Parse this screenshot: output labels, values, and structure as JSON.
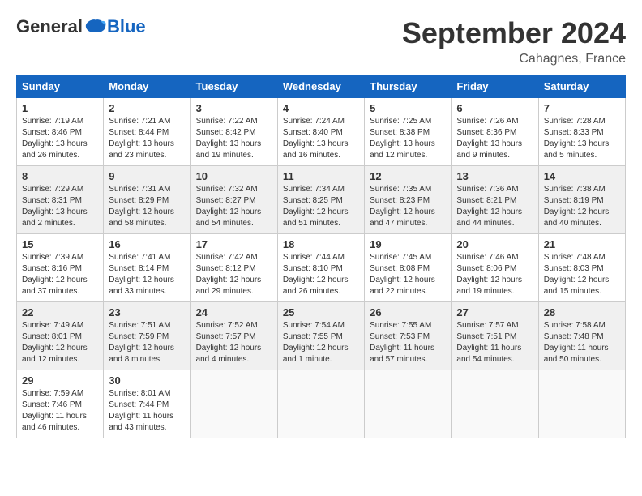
{
  "header": {
    "logo": {
      "general": "General",
      "blue": "Blue"
    },
    "title": "September 2024",
    "location": "Cahagnes, France"
  },
  "weekdays": [
    "Sunday",
    "Monday",
    "Tuesday",
    "Wednesday",
    "Thursday",
    "Friday",
    "Saturday"
  ],
  "weeks": [
    [
      {
        "day": "1",
        "sunrise": "Sunrise: 7:19 AM",
        "sunset": "Sunset: 8:46 PM",
        "daylight": "Daylight: 13 hours and 26 minutes."
      },
      {
        "day": "2",
        "sunrise": "Sunrise: 7:21 AM",
        "sunset": "Sunset: 8:44 PM",
        "daylight": "Daylight: 13 hours and 23 minutes."
      },
      {
        "day": "3",
        "sunrise": "Sunrise: 7:22 AM",
        "sunset": "Sunset: 8:42 PM",
        "daylight": "Daylight: 13 hours and 19 minutes."
      },
      {
        "day": "4",
        "sunrise": "Sunrise: 7:24 AM",
        "sunset": "Sunset: 8:40 PM",
        "daylight": "Daylight: 13 hours and 16 minutes."
      },
      {
        "day": "5",
        "sunrise": "Sunrise: 7:25 AM",
        "sunset": "Sunset: 8:38 PM",
        "daylight": "Daylight: 13 hours and 12 minutes."
      },
      {
        "day": "6",
        "sunrise": "Sunrise: 7:26 AM",
        "sunset": "Sunset: 8:36 PM",
        "daylight": "Daylight: 13 hours and 9 minutes."
      },
      {
        "day": "7",
        "sunrise": "Sunrise: 7:28 AM",
        "sunset": "Sunset: 8:33 PM",
        "daylight": "Daylight: 13 hours and 5 minutes."
      }
    ],
    [
      {
        "day": "8",
        "sunrise": "Sunrise: 7:29 AM",
        "sunset": "Sunset: 8:31 PM",
        "daylight": "Daylight: 13 hours and 2 minutes."
      },
      {
        "day": "9",
        "sunrise": "Sunrise: 7:31 AM",
        "sunset": "Sunset: 8:29 PM",
        "daylight": "Daylight: 12 hours and 58 minutes."
      },
      {
        "day": "10",
        "sunrise": "Sunrise: 7:32 AM",
        "sunset": "Sunset: 8:27 PM",
        "daylight": "Daylight: 12 hours and 54 minutes."
      },
      {
        "day": "11",
        "sunrise": "Sunrise: 7:34 AM",
        "sunset": "Sunset: 8:25 PM",
        "daylight": "Daylight: 12 hours and 51 minutes."
      },
      {
        "day": "12",
        "sunrise": "Sunrise: 7:35 AM",
        "sunset": "Sunset: 8:23 PM",
        "daylight": "Daylight: 12 hours and 47 minutes."
      },
      {
        "day": "13",
        "sunrise": "Sunrise: 7:36 AM",
        "sunset": "Sunset: 8:21 PM",
        "daylight": "Daylight: 12 hours and 44 minutes."
      },
      {
        "day": "14",
        "sunrise": "Sunrise: 7:38 AM",
        "sunset": "Sunset: 8:19 PM",
        "daylight": "Daylight: 12 hours and 40 minutes."
      }
    ],
    [
      {
        "day": "15",
        "sunrise": "Sunrise: 7:39 AM",
        "sunset": "Sunset: 8:16 PM",
        "daylight": "Daylight: 12 hours and 37 minutes."
      },
      {
        "day": "16",
        "sunrise": "Sunrise: 7:41 AM",
        "sunset": "Sunset: 8:14 PM",
        "daylight": "Daylight: 12 hours and 33 minutes."
      },
      {
        "day": "17",
        "sunrise": "Sunrise: 7:42 AM",
        "sunset": "Sunset: 8:12 PM",
        "daylight": "Daylight: 12 hours and 29 minutes."
      },
      {
        "day": "18",
        "sunrise": "Sunrise: 7:44 AM",
        "sunset": "Sunset: 8:10 PM",
        "daylight": "Daylight: 12 hours and 26 minutes."
      },
      {
        "day": "19",
        "sunrise": "Sunrise: 7:45 AM",
        "sunset": "Sunset: 8:08 PM",
        "daylight": "Daylight: 12 hours and 22 minutes."
      },
      {
        "day": "20",
        "sunrise": "Sunrise: 7:46 AM",
        "sunset": "Sunset: 8:06 PM",
        "daylight": "Daylight: 12 hours and 19 minutes."
      },
      {
        "day": "21",
        "sunrise": "Sunrise: 7:48 AM",
        "sunset": "Sunset: 8:03 PM",
        "daylight": "Daylight: 12 hours and 15 minutes."
      }
    ],
    [
      {
        "day": "22",
        "sunrise": "Sunrise: 7:49 AM",
        "sunset": "Sunset: 8:01 PM",
        "daylight": "Daylight: 12 hours and 12 minutes."
      },
      {
        "day": "23",
        "sunrise": "Sunrise: 7:51 AM",
        "sunset": "Sunset: 7:59 PM",
        "daylight": "Daylight: 12 hours and 8 minutes."
      },
      {
        "day": "24",
        "sunrise": "Sunrise: 7:52 AM",
        "sunset": "Sunset: 7:57 PM",
        "daylight": "Daylight: 12 hours and 4 minutes."
      },
      {
        "day": "25",
        "sunrise": "Sunrise: 7:54 AM",
        "sunset": "Sunset: 7:55 PM",
        "daylight": "Daylight: 12 hours and 1 minute."
      },
      {
        "day": "26",
        "sunrise": "Sunrise: 7:55 AM",
        "sunset": "Sunset: 7:53 PM",
        "daylight": "Daylight: 11 hours and 57 minutes."
      },
      {
        "day": "27",
        "sunrise": "Sunrise: 7:57 AM",
        "sunset": "Sunset: 7:51 PM",
        "daylight": "Daylight: 11 hours and 54 minutes."
      },
      {
        "day": "28",
        "sunrise": "Sunrise: 7:58 AM",
        "sunset": "Sunset: 7:48 PM",
        "daylight": "Daylight: 11 hours and 50 minutes."
      }
    ],
    [
      {
        "day": "29",
        "sunrise": "Sunrise: 7:59 AM",
        "sunset": "Sunset: 7:46 PM",
        "daylight": "Daylight: 11 hours and 46 minutes."
      },
      {
        "day": "30",
        "sunrise": "Sunrise: 8:01 AM",
        "sunset": "Sunset: 7:44 PM",
        "daylight": "Daylight: 11 hours and 43 minutes."
      },
      null,
      null,
      null,
      null,
      null
    ]
  ]
}
